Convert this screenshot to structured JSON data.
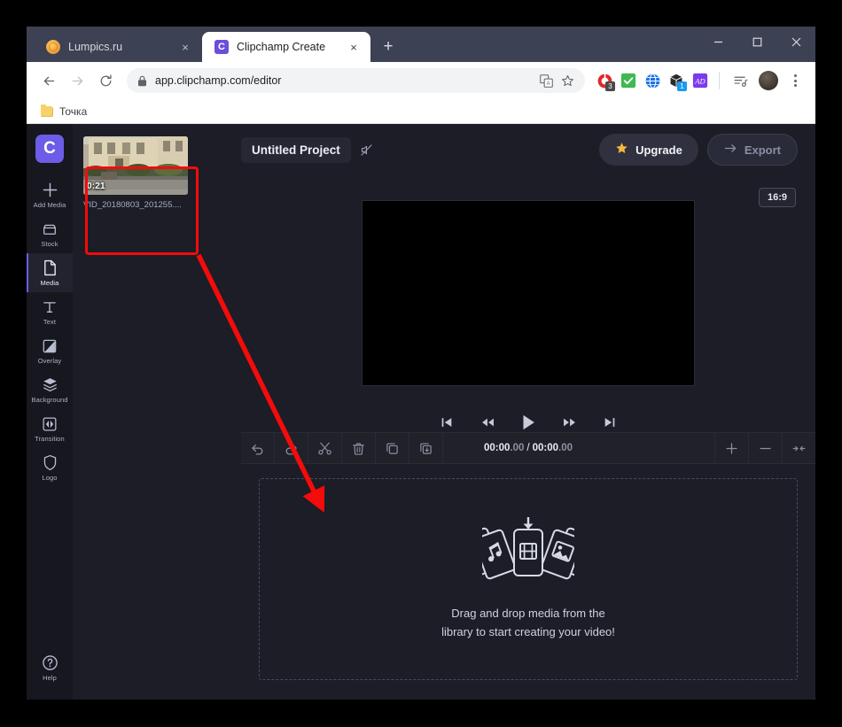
{
  "browser": {
    "tabs": [
      {
        "title": "Lumpics.ru",
        "favicon": "lumpics-favicon",
        "active": false,
        "close_label": "×"
      },
      {
        "title": "Clipchamp Create",
        "favicon": "clipchamp-favicon",
        "favicon_letter": "C",
        "active": true,
        "close_label": "×"
      }
    ],
    "new_tab_label": "+",
    "window_controls": {
      "minimize": "─",
      "maximize": "☐",
      "close": "✕"
    },
    "nav": {
      "back": "←",
      "forward": "→",
      "reload": "⟳"
    },
    "omnibox": {
      "url": "app.clipchamp.com/editor",
      "lock_icon": "lock-icon",
      "translate_icon": "translate-icon",
      "star_icon": "bookmark-star-icon"
    },
    "extensions": [
      {
        "name": "adblock-extension",
        "badge": "3",
        "badge_color": "#4a4a4a",
        "color": "#e02a2a"
      },
      {
        "name": "checkmark-extension",
        "badge": "",
        "color": "#3fb950"
      },
      {
        "name": "globe-extension",
        "badge": "",
        "color": "#1a73e8"
      },
      {
        "name": "box-extension",
        "badge": "1",
        "badge_color": "#1a9bf0",
        "color": "#2b2b2b"
      },
      {
        "name": "purple-extension",
        "badge": "",
        "color": "#7c3aed"
      }
    ],
    "reading_list_icon": "reading-list-icon",
    "profile_avatar": "profile-avatar",
    "menu_icon": "kebab-menu-icon",
    "bookmarks": [
      {
        "label": "Точка",
        "icon": "folder-icon"
      }
    ]
  },
  "app": {
    "brand_logo": "C",
    "sidebar": [
      {
        "label": "Add Media",
        "icon": "plus-icon",
        "active": false
      },
      {
        "label": "Stock",
        "icon": "stock-icon",
        "active": false
      },
      {
        "label": "Media",
        "icon": "media-file-icon",
        "active": true
      },
      {
        "label": "Text",
        "icon": "text-icon",
        "active": false
      },
      {
        "label": "Overlay",
        "icon": "overlay-icon",
        "active": false
      },
      {
        "label": "Background",
        "icon": "layers-icon",
        "active": false
      },
      {
        "label": "Transition",
        "icon": "transition-icon",
        "active": false
      },
      {
        "label": "Logo",
        "icon": "shield-icon",
        "active": false
      }
    ],
    "sidebar_bottom": {
      "label": "Help",
      "icon": "help-circle-icon"
    },
    "library": {
      "items": [
        {
          "name": "VID_20180803_201255....",
          "duration": "0:21",
          "thumbnail": "building-video-thumbnail"
        }
      ]
    },
    "topbar": {
      "project_title": "Untitled Project",
      "project_icon": "mute-icon",
      "upgrade_label": "Upgrade",
      "upgrade_icon": "star-icon",
      "export_label": "Export",
      "export_icon": "arrow-right-icon"
    },
    "stage": {
      "aspect_ratio": "16:9",
      "preview_color": "#000000",
      "transport": [
        {
          "name": "skip-to-start-button",
          "icon": "skip-start-icon"
        },
        {
          "name": "rewind-button",
          "icon": "rewind-icon"
        },
        {
          "name": "play-button",
          "icon": "play-icon"
        },
        {
          "name": "fast-forward-button",
          "icon": "fast-forward-icon"
        },
        {
          "name": "skip-to-end-button",
          "icon": "skip-end-icon"
        }
      ]
    },
    "timeline": {
      "tools_left": [
        {
          "name": "undo-button",
          "icon": "undo-icon"
        },
        {
          "name": "redo-button",
          "icon": "redo-icon"
        },
        {
          "name": "split-button",
          "icon": "scissors-icon"
        },
        {
          "name": "delete-button",
          "icon": "trash-icon"
        },
        {
          "name": "duplicate-button",
          "icon": "copy-icon"
        },
        {
          "name": "copy-download-button",
          "icon": "copy-download-icon"
        }
      ],
      "tools_right": [
        {
          "name": "zoom-in-button",
          "icon": "plus-icon"
        },
        {
          "name": "zoom-out-button",
          "icon": "minus-icon"
        },
        {
          "name": "fit-timeline-button",
          "icon": "fit-icon"
        }
      ],
      "current_time": "00:00",
      "current_frac": ".00",
      "separator": "/",
      "total_time": "00:00",
      "total_frac": ".00",
      "dropzone": {
        "line1": "Drag and drop media from the",
        "line2": "library to start creating your video!",
        "icon": "media-cards-icon"
      }
    }
  },
  "annotations": {
    "highlight_color": "#f40b0b",
    "highlight_target": "media-library-item",
    "arrow_from": "media-library-item",
    "arrow_to": "timeline-dropzone"
  }
}
